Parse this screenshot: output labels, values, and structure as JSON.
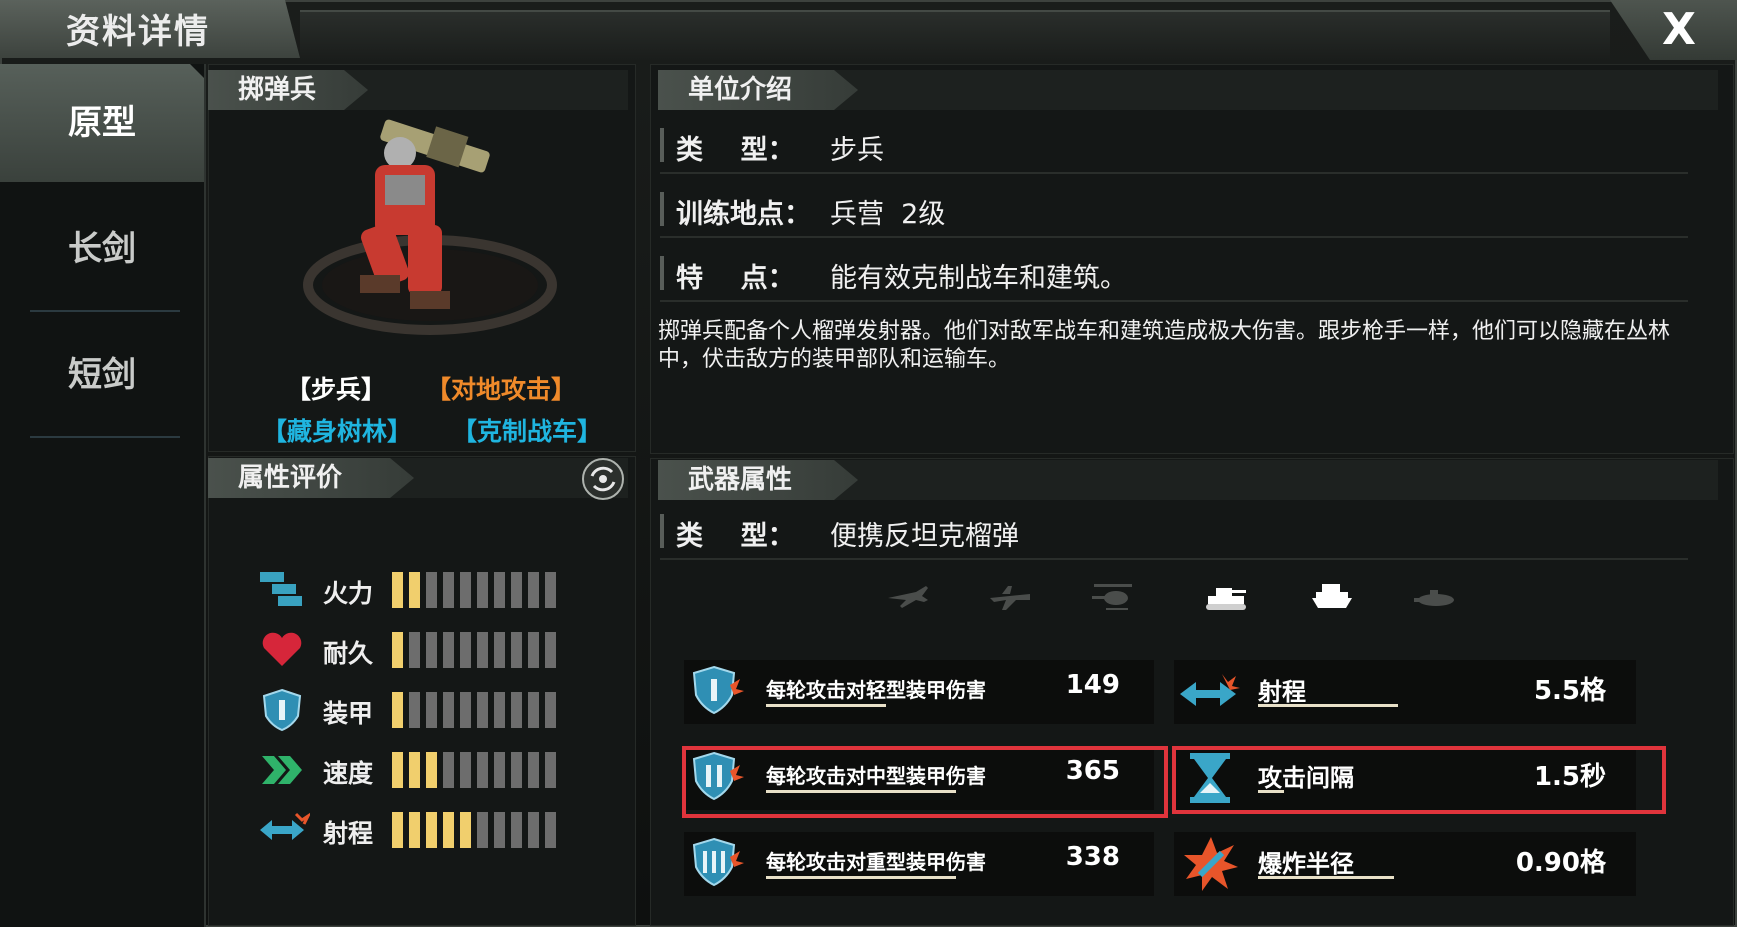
{
  "window": {
    "title": "资料详情",
    "close_label": "X"
  },
  "sidebar": {
    "tabs": [
      {
        "label": "原型",
        "active": true
      },
      {
        "label": "长剑",
        "active": false
      },
      {
        "label": "短剑",
        "active": false
      }
    ]
  },
  "unit": {
    "name_header": "掷弹兵",
    "tags": [
      {
        "text": "【步兵】",
        "color": "#ffffff"
      },
      {
        "text": "【对地攻击】",
        "color": "#f08a2a"
      },
      {
        "text": "【藏身树林】",
        "color": "#1fb5e0"
      },
      {
        "text": "【克制战车】",
        "color": "#1fb5e0"
      }
    ]
  },
  "attributes": {
    "header": "属性评价",
    "max_segments": 10,
    "stats": [
      {
        "label": "火力",
        "icon": "firepower-icon",
        "level": 2
      },
      {
        "label": "耐久",
        "icon": "heart-icon",
        "level": 1
      },
      {
        "label": "装甲",
        "icon": "armor-shield-icon",
        "level": 1
      },
      {
        "label": "速度",
        "icon": "speed-chevron-icon",
        "level": 3
      },
      {
        "label": "射程",
        "icon": "range-arrow-icon",
        "level": 5
      }
    ]
  },
  "intro": {
    "header": "单位介绍",
    "rows": [
      {
        "key": "类    型：",
        "value": "步兵"
      },
      {
        "key": "训练地点：",
        "value": "兵营  2级"
      },
      {
        "key": "特    点：",
        "value": "能有效克制战车和建筑。"
      }
    ],
    "description": "掷弹兵配备个人榴弹发射器。他们对敌军战车和建筑造成极大伤害。跟步枪手一样，他们可以隐藏在丛林中，伏击敌方的装甲部队和运输车。"
  },
  "weapon": {
    "header": "武器属性",
    "type_key": "类    型：",
    "type_value": "便携反坦克榴弹",
    "targets": [
      {
        "icon": "fighter-jet-icon",
        "active": false
      },
      {
        "icon": "bomber-plane-icon",
        "active": false
      },
      {
        "icon": "helicopter-icon",
        "active": false
      },
      {
        "icon": "tank-icon",
        "active": true
      },
      {
        "icon": "ship-icon",
        "active": true
      },
      {
        "icon": "submarine-icon",
        "active": false
      }
    ],
    "damage": [
      {
        "label": "每轮攻击对轻型装甲伤害",
        "value": "149",
        "icon": "light-armor-icon",
        "highlight": false
      },
      {
        "label": "每轮攻击对中型装甲伤害",
        "value": "365",
        "icon": "medium-armor-icon",
        "highlight": true
      },
      {
        "label": "每轮攻击对重型装甲伤害",
        "value": "338",
        "icon": "heavy-armor-icon",
        "highlight": false
      }
    ],
    "props": [
      {
        "label": "射程",
        "value": "5.5格",
        "icon": "range-arrow-icon",
        "highlight": false
      },
      {
        "label": "攻击间隔",
        "value": "1.5秒",
        "icon": "hourglass-icon",
        "highlight": true
      },
      {
        "label": "爆炸半径",
        "value": "0.90格",
        "icon": "explosion-icon",
        "highlight": false
      }
    ]
  }
}
